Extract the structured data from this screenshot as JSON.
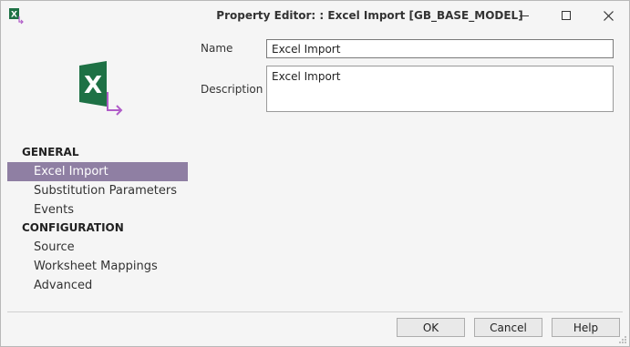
{
  "window": {
    "title": "Property Editor: : Excel Import [GB_BASE_MODEL]",
    "app_icon": "excel-import-icon",
    "controls": {
      "minimize": "minimize-icon",
      "maximize": "maximize-icon",
      "close": "close-icon"
    }
  },
  "sidebar": {
    "logo_icon": "excel-import-logo-icon",
    "sections": [
      {
        "label": "GENERAL",
        "items": [
          {
            "label": "Excel Import",
            "selected": true
          },
          {
            "label": "Substitution Parameters",
            "selected": false
          },
          {
            "label": "Events",
            "selected": false
          }
        ]
      },
      {
        "label": "CONFIGURATION",
        "items": [
          {
            "label": "Source",
            "selected": false
          },
          {
            "label": "Worksheet Mappings",
            "selected": false
          },
          {
            "label": "Advanced",
            "selected": false
          }
        ]
      }
    ]
  },
  "form": {
    "name_label": "Name",
    "name_value": "Excel Import",
    "description_label": "Description",
    "description_value": "Excel Import"
  },
  "footer": {
    "ok_label": "OK",
    "cancel_label": "Cancel",
    "help_label": "Help"
  },
  "colors": {
    "selection": "#8f7fa3",
    "excel_green": "#1e7145",
    "arrow_purple": "#b05cc8"
  }
}
